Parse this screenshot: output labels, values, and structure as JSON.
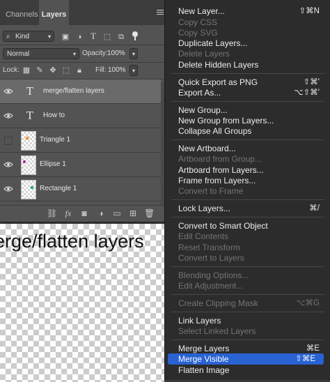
{
  "panel": {
    "tabs": [
      {
        "label": "Channels"
      },
      {
        "label": "Layers"
      }
    ],
    "filter": {
      "label": "Kind"
    },
    "blend_mode": "Normal",
    "opacity": {
      "label": "Opacity:",
      "value": "100%"
    },
    "lock": {
      "label": "Lock:"
    },
    "fill": {
      "label": "Fill:",
      "value": "100%"
    }
  },
  "layers": [
    {
      "name": "merge/flatten layers",
      "kind": "text",
      "visible": true,
      "selected": true
    },
    {
      "name": "How to",
      "kind": "text",
      "visible": true,
      "selected": false
    },
    {
      "name": "Triangle 1",
      "kind": "shape",
      "visible": false,
      "selected": false,
      "accent": "#f08a20"
    },
    {
      "name": "Ellipse 1",
      "kind": "shape",
      "visible": true,
      "selected": false,
      "accent": "#a020a0"
    },
    {
      "name": "Rectangle 1",
      "kind": "shape",
      "visible": true,
      "selected": false,
      "accent": "#2aa58f"
    }
  ],
  "canvas": {
    "text": "erge/flatten layers"
  },
  "menu": {
    "items": [
      {
        "label": "New Layer...",
        "shortcut": "⇧⌘N"
      },
      {
        "label": "Copy CSS",
        "disabled": true
      },
      {
        "label": "Copy SVG",
        "disabled": true
      },
      {
        "label": "Duplicate Layers..."
      },
      {
        "label": "Delete Layers",
        "disabled": true
      },
      {
        "label": "Delete Hidden Layers"
      },
      {
        "label": "Quick Export as PNG",
        "shortcut": "⇧⌘'"
      },
      {
        "label": "Export As...",
        "shortcut": "⌥⇧⌘'"
      },
      {
        "label": "New Group..."
      },
      {
        "label": "New Group from Layers..."
      },
      {
        "label": "Collapse All Groups"
      },
      {
        "label": "New Artboard..."
      },
      {
        "label": "Artboard from Group...",
        "disabled": true
      },
      {
        "label": "Artboard from Layers..."
      },
      {
        "label": "Frame from Layers..."
      },
      {
        "label": "Convert to Frame",
        "disabled": true
      },
      {
        "label": "Lock Layers...",
        "shortcut": "⌘/"
      },
      {
        "label": "Convert to Smart Object"
      },
      {
        "label": "Edit Contents",
        "disabled": true
      },
      {
        "label": "Reset Transform",
        "disabled": true
      },
      {
        "label": "Convert to Layers",
        "disabled": true
      },
      {
        "label": "Blending Options...",
        "disabled": true
      },
      {
        "label": "Edit Adjustment...",
        "disabled": true
      },
      {
        "label": "Create Clipping Mask",
        "shortcut": "⌥⌘G",
        "disabled": true
      },
      {
        "label": "Link Layers"
      },
      {
        "label": "Select Linked Layers",
        "disabled": true
      },
      {
        "label": "Merge Layers",
        "shortcut": "⌘E"
      },
      {
        "label": "Merge Visible",
        "shortcut": "⇧⌘E",
        "highlighted": true
      },
      {
        "label": "Flatten Image"
      }
    ]
  },
  "colors": {
    "accent": "#2862d3",
    "panel": "#535353",
    "menu": "#2c2c2c"
  }
}
